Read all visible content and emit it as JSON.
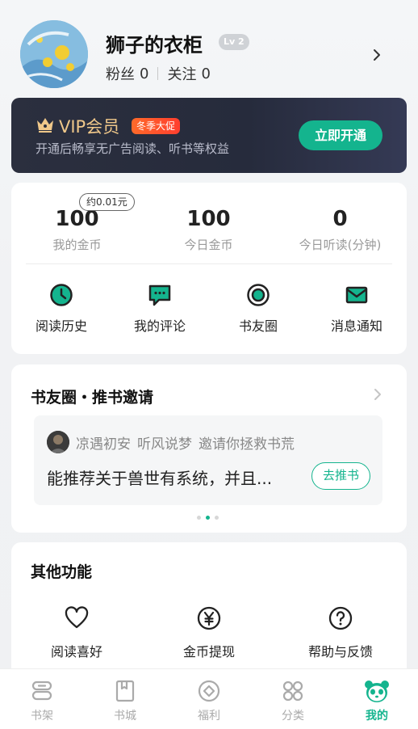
{
  "profile": {
    "username": "狮子的衣柜",
    "level": "Lv 2",
    "fans_label": "粉丝",
    "fans_count": "0",
    "following_label": "关注",
    "following_count": "0"
  },
  "vip": {
    "title": "VIP会员",
    "promo_badge": "冬季大促",
    "description": "开通后畅享无广告阅读、听书等权益",
    "button_label": "立即开通",
    "accent_color": "#14b48e",
    "title_color": "#f0c88a"
  },
  "stats": {
    "coin_tip": "约0.01元",
    "items": [
      {
        "value": "100",
        "label": "我的金币"
      },
      {
        "value": "100",
        "label": "今日金币"
      },
      {
        "value": "0",
        "label": "今日听读(分钟)"
      }
    ]
  },
  "quick_actions": [
    {
      "label": "阅读历史",
      "icon": "clock-icon"
    },
    {
      "label": "我的评论",
      "icon": "comment-icon"
    },
    {
      "label": "书友圈",
      "icon": "circle-icon"
    },
    {
      "label": "消息通知",
      "icon": "mail-icon"
    }
  ],
  "book_circle": {
    "title": "书友圈・推书邀请",
    "user": "凉遇初安",
    "target": "听风说梦",
    "invite_text": "邀请你拯救书荒",
    "request": "能推荐关于兽世有系统，并且...",
    "button_label": "去推书"
  },
  "other_functions": {
    "title": "其他功能",
    "items": [
      {
        "label": "阅读喜好",
        "icon": "heart-icon"
      },
      {
        "label": "金币提现",
        "icon": "yen-icon"
      },
      {
        "label": "帮助与反馈",
        "icon": "help-icon"
      }
    ]
  },
  "tabbar": [
    {
      "label": "书架",
      "icon": "bookshelf-icon",
      "active": false
    },
    {
      "label": "书城",
      "icon": "bookstore-icon",
      "active": false
    },
    {
      "label": "福利",
      "icon": "welfare-icon",
      "active": false
    },
    {
      "label": "分类",
      "icon": "category-icon",
      "active": false
    },
    {
      "label": "我的",
      "icon": "panda-icon",
      "active": true
    }
  ]
}
